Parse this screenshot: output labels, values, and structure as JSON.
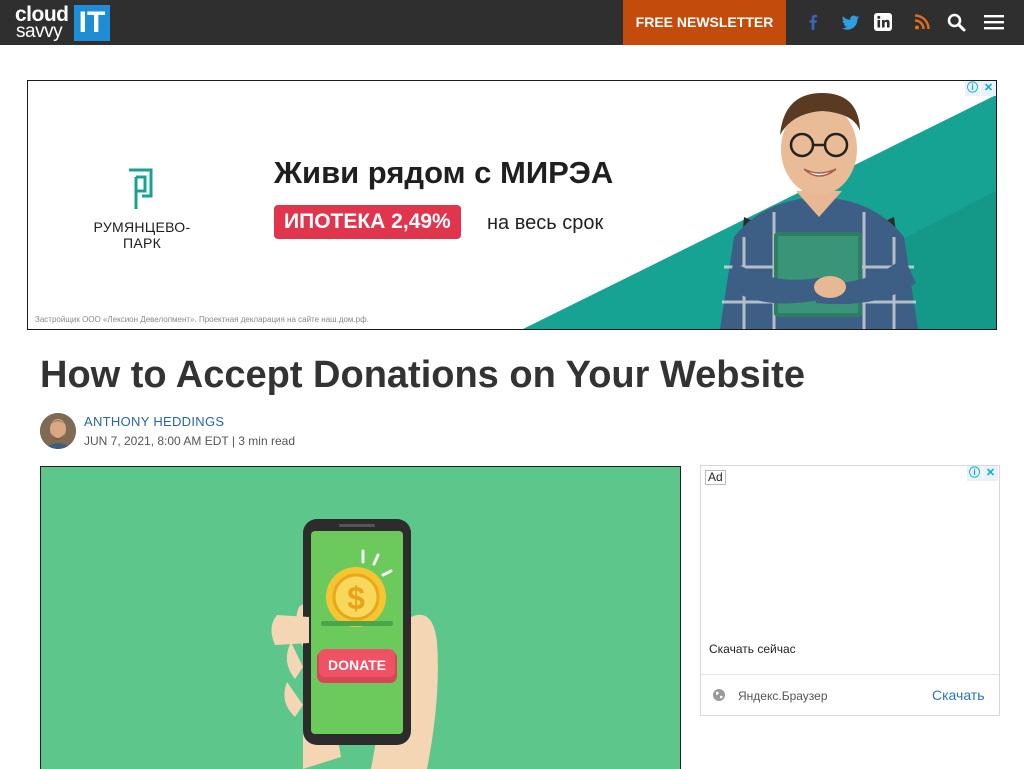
{
  "header": {
    "logo": {
      "line1": "cloud",
      "line2": "savvy",
      "badge": "IT"
    },
    "newsletter_label": "FREE NEWSLETTER",
    "icons": [
      "facebook-icon",
      "twitter-icon",
      "linkedin-icon",
      "rss-icon",
      "search-icon",
      "hamburger-menu-icon"
    ],
    "bar_color": "#2f2f30",
    "accent_color": "#c34b0c"
  },
  "banner_ad": {
    "brand": "РУМЯНЦЕВО-ПАРК",
    "headline": "Живи рядом с МИРЭА",
    "promo": "ИПОТЕКА 2,49%",
    "promo_suffix": "на весь срок",
    "disclaimer": "Застройщик ООО «Лексион Девелопмент». Проектная декларация на сайте наш.дом.рф.",
    "info_icon": "ⓘ",
    "close_icon": "✕",
    "teal_color": "#17a394",
    "promo_color": "#e1344d"
  },
  "article": {
    "title": "How to Accept Donations on Your Website",
    "author": "ANTHONY HEDDINGS",
    "meta": "JUN 7, 2021, 8:00 AM EDT | 3 min read",
    "hero": {
      "button_text": "DONATE",
      "coin_symbol": "$"
    }
  },
  "side_ad": {
    "label": "Ad",
    "info_icon": "ⓘ",
    "close_icon": "✕",
    "text": "Скачать сейчас",
    "browser": "Яндекс.Браузер",
    "download": "Скачать"
  }
}
